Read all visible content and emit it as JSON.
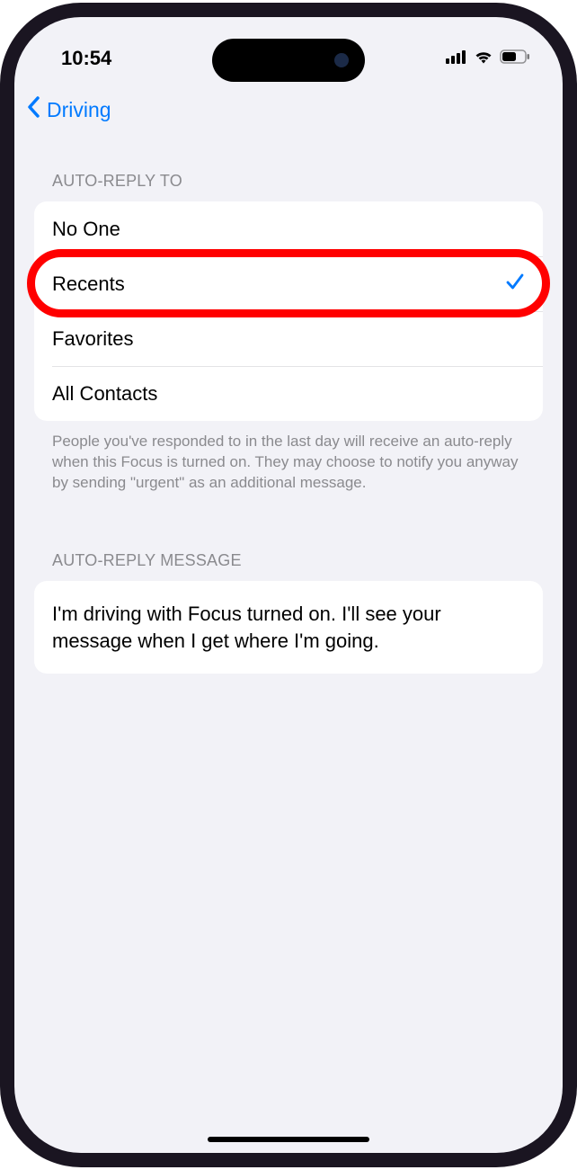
{
  "status": {
    "time": "10:54"
  },
  "nav": {
    "back_label": "Driving"
  },
  "auto_reply_to": {
    "header": "AUTO-REPLY TO",
    "options": [
      {
        "label": "No One",
        "selected": false
      },
      {
        "label": "Recents",
        "selected": true
      },
      {
        "label": "Favorites",
        "selected": false
      },
      {
        "label": "All Contacts",
        "selected": false
      }
    ],
    "footer": "People you've responded to in the last day will receive an auto-reply when this Focus is turned on. They may choose to notify you anyway by sending \"urgent\" as an additional message."
  },
  "auto_reply_message": {
    "header": "AUTO-REPLY MESSAGE",
    "text": "I'm driving with Focus turned on. I'll see your message when I get where I'm going."
  },
  "annotation": {
    "highlighted_index": 1
  },
  "colors": {
    "accent": "#007aff",
    "highlight": "#ff0000"
  }
}
